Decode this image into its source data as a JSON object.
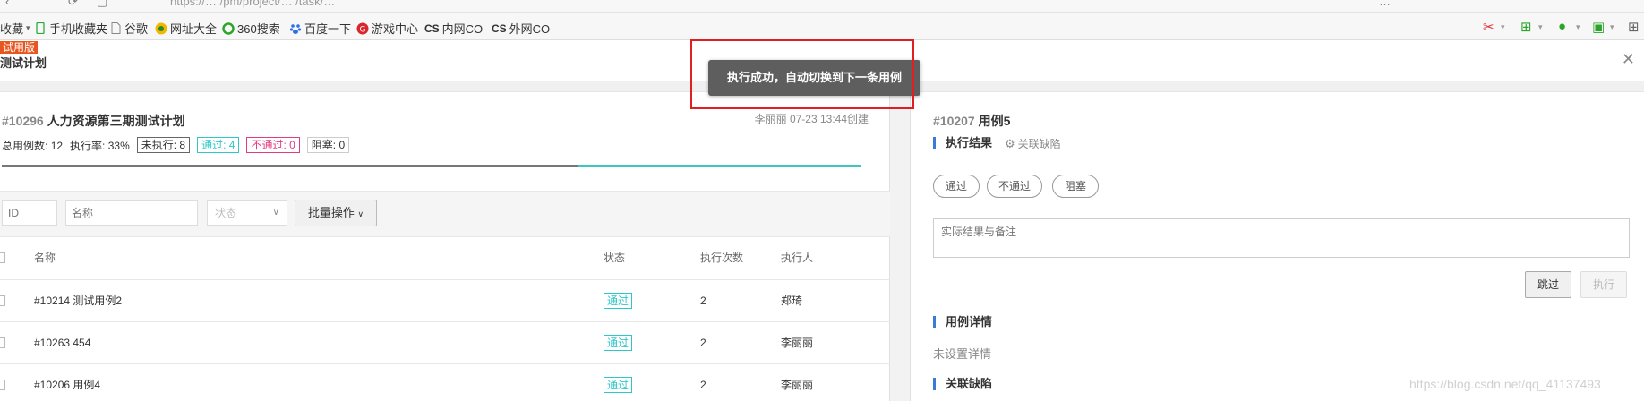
{
  "browser": {
    "url": "https://… /pm/project/… /task/… ",
    "back_icon": "chevron-left-icon",
    "right_tab_text": "…"
  },
  "bookmarks": [
    {
      "label": "收藏",
      "icon": "star-icon"
    },
    {
      "label": "手机收藏夹",
      "icon": "phone-icon"
    },
    {
      "label": "谷歌",
      "icon": "page-icon"
    },
    {
      "label": "网址大全",
      "icon": "globe-icon"
    },
    {
      "label": "360搜索",
      "icon": "ring-icon"
    },
    {
      "label": "百度一下",
      "icon": "paw-icon"
    },
    {
      "label": "游戏中心",
      "icon": "game-icon"
    },
    {
      "label": "内网CO",
      "icon": "cs-icon"
    },
    {
      "label": "外网CO",
      "icon": "cs-icon"
    }
  ],
  "app": {
    "badge": "试用版",
    "title": "测试计划"
  },
  "plan": {
    "id": "#10296",
    "name": "人力资源第三期测试计划",
    "creator_info": "李丽丽 07-23 13:44创建",
    "stats": {
      "total_label": "总用例数:",
      "total_value": "12",
      "rate_label": "执行率:",
      "rate_value": "33%",
      "unexecuted": "未执行: 8",
      "passed": "通过: 4",
      "failed": "不通过: 0",
      "blocked": "阻塞: 0"
    },
    "progress_fraction": 0.33
  },
  "filters": {
    "id_placeholder": "ID",
    "name_placeholder": "名称",
    "status_placeholder": "状态",
    "batch_label": "批量操作"
  },
  "table": {
    "headers": {
      "name": "名称",
      "status": "状态",
      "count": "执行次数",
      "executor": "执行人"
    },
    "rows": [
      {
        "name": "#10214 测试用例2",
        "status": "通过",
        "count": "2",
        "executor": "郑琦"
      },
      {
        "name": "#10263 454",
        "status": "通过",
        "count": "2",
        "executor": "李丽丽"
      },
      {
        "name": "#10206 用例4",
        "status": "通过",
        "count": "2",
        "executor": "李丽丽"
      }
    ]
  },
  "case": {
    "id": "#10207",
    "name": "用例5",
    "result_title": "执行结果",
    "link_defect": "关联缺陷",
    "buttons": {
      "pass": "通过",
      "fail": "不通过",
      "block": "阻塞"
    },
    "remark_placeholder": "实际结果与备注",
    "skip": "跳过",
    "execute": "执行",
    "detail_title": "用例详情",
    "detail_empty": "未设置详情",
    "defect_title": "关联缺陷"
  },
  "toast": {
    "message": "执行成功，自动切换到下一条用例"
  },
  "watermark": "https://blog.csdn.net/qq_41137493"
}
